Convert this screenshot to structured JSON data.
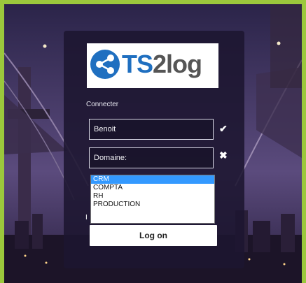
{
  "logo": {
    "text_ts": "TS",
    "text_2": "2",
    "text_log": "log",
    "icon": "share-network-icon"
  },
  "form": {
    "label": "Connecter",
    "user_value": "Benoit",
    "domain_value": "Domaine:",
    "user_status_icon": "checkmark-icon",
    "domain_status_icon": "cross-icon",
    "domain_options": [
      "CRM",
      "COMPTA",
      "RH",
      "PRODUCTION"
    ],
    "selected_option": "CRM",
    "partial_char": "I",
    "logon_label": "Log on"
  },
  "colors": {
    "frame": "#9bc83c",
    "selection": "#3399ff",
    "brand_blue": "#1f6fc0"
  }
}
